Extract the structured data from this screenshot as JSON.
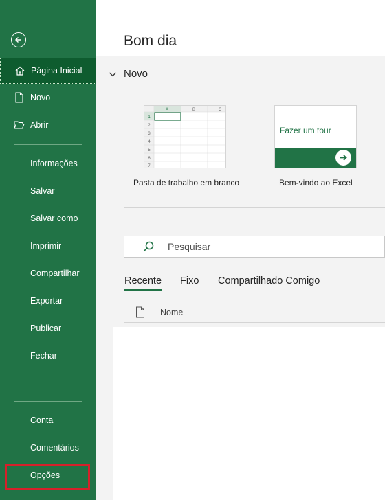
{
  "sidebar": {
    "back_icon": "back-arrow-icon",
    "items": [
      {
        "label": "Página Inicial",
        "icon": "home-icon",
        "selected": true
      },
      {
        "label": "Novo",
        "icon": "new-document-icon"
      },
      {
        "label": "Abrir",
        "icon": "folder-open-icon"
      },
      {
        "label": "Informações"
      },
      {
        "label": "Salvar"
      },
      {
        "label": "Salvar como"
      },
      {
        "label": "Imprimir"
      },
      {
        "label": "Compartilhar"
      },
      {
        "label": "Exportar"
      },
      {
        "label": "Publicar"
      },
      {
        "label": "Fechar"
      },
      {
        "label": "Conta"
      },
      {
        "label": "Comentários"
      },
      {
        "label": "Opções",
        "highlighted": true
      }
    ]
  },
  "main": {
    "greeting": "Bom dia",
    "new_section_label": "Novo",
    "templates": [
      {
        "label": "Pasta de trabalho em branco"
      },
      {
        "label": "Bem-vindo ao Excel",
        "thumb_text": "Fazer um tour"
      }
    ],
    "blank_thumb": {
      "columns": [
        "A",
        "B",
        "C"
      ],
      "rows": [
        "1",
        "2",
        "3",
        "4",
        "5",
        "6",
        "7"
      ]
    },
    "search": {
      "placeholder": "Pesquisar"
    },
    "tabs": [
      {
        "label": "Recente",
        "active": true
      },
      {
        "label": "Fixo"
      },
      {
        "label": "Compartilhado Comigo"
      }
    ],
    "list_header": {
      "name_col": "Nome"
    }
  },
  "colors": {
    "accent": "#217346",
    "selected_bg": "#0e5c2f",
    "highlight": "#d6202a"
  }
}
